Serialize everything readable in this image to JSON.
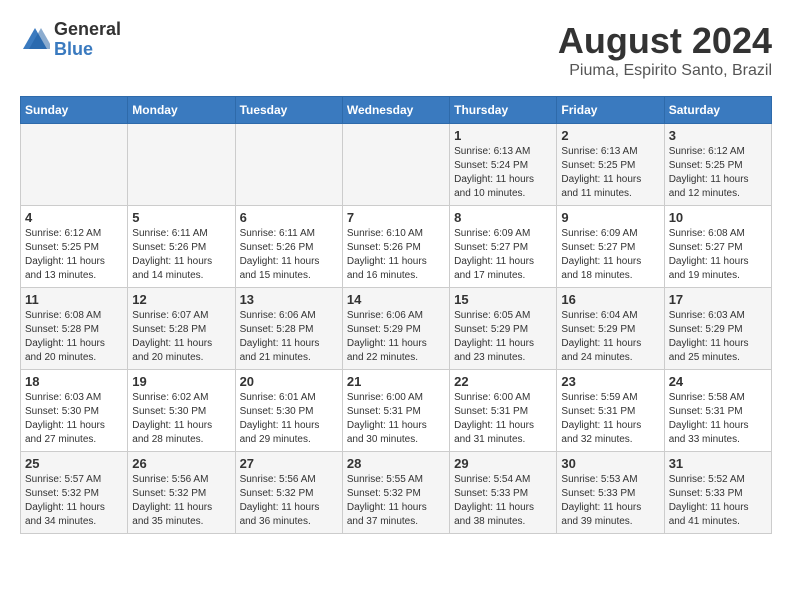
{
  "logo": {
    "line1": "General",
    "line2": "Blue"
  },
  "title": "August 2024",
  "subtitle": "Piuma, Espirito Santo, Brazil",
  "days_of_week": [
    "Sunday",
    "Monday",
    "Tuesday",
    "Wednesday",
    "Thursday",
    "Friday",
    "Saturday"
  ],
  "weeks": [
    [
      {
        "day": "",
        "info": ""
      },
      {
        "day": "",
        "info": ""
      },
      {
        "day": "",
        "info": ""
      },
      {
        "day": "",
        "info": ""
      },
      {
        "day": "1",
        "info": "Sunrise: 6:13 AM\nSunset: 5:24 PM\nDaylight: 11 hours\nand 10 minutes."
      },
      {
        "day": "2",
        "info": "Sunrise: 6:13 AM\nSunset: 5:25 PM\nDaylight: 11 hours\nand 11 minutes."
      },
      {
        "day": "3",
        "info": "Sunrise: 6:12 AM\nSunset: 5:25 PM\nDaylight: 11 hours\nand 12 minutes."
      }
    ],
    [
      {
        "day": "4",
        "info": "Sunrise: 6:12 AM\nSunset: 5:25 PM\nDaylight: 11 hours\nand 13 minutes."
      },
      {
        "day": "5",
        "info": "Sunrise: 6:11 AM\nSunset: 5:26 PM\nDaylight: 11 hours\nand 14 minutes."
      },
      {
        "day": "6",
        "info": "Sunrise: 6:11 AM\nSunset: 5:26 PM\nDaylight: 11 hours\nand 15 minutes."
      },
      {
        "day": "7",
        "info": "Sunrise: 6:10 AM\nSunset: 5:26 PM\nDaylight: 11 hours\nand 16 minutes."
      },
      {
        "day": "8",
        "info": "Sunrise: 6:09 AM\nSunset: 5:27 PM\nDaylight: 11 hours\nand 17 minutes."
      },
      {
        "day": "9",
        "info": "Sunrise: 6:09 AM\nSunset: 5:27 PM\nDaylight: 11 hours\nand 18 minutes."
      },
      {
        "day": "10",
        "info": "Sunrise: 6:08 AM\nSunset: 5:27 PM\nDaylight: 11 hours\nand 19 minutes."
      }
    ],
    [
      {
        "day": "11",
        "info": "Sunrise: 6:08 AM\nSunset: 5:28 PM\nDaylight: 11 hours\nand 20 minutes."
      },
      {
        "day": "12",
        "info": "Sunrise: 6:07 AM\nSunset: 5:28 PM\nDaylight: 11 hours\nand 20 minutes."
      },
      {
        "day": "13",
        "info": "Sunrise: 6:06 AM\nSunset: 5:28 PM\nDaylight: 11 hours\nand 21 minutes."
      },
      {
        "day": "14",
        "info": "Sunrise: 6:06 AM\nSunset: 5:29 PM\nDaylight: 11 hours\nand 22 minutes."
      },
      {
        "day": "15",
        "info": "Sunrise: 6:05 AM\nSunset: 5:29 PM\nDaylight: 11 hours\nand 23 minutes."
      },
      {
        "day": "16",
        "info": "Sunrise: 6:04 AM\nSunset: 5:29 PM\nDaylight: 11 hours\nand 24 minutes."
      },
      {
        "day": "17",
        "info": "Sunrise: 6:03 AM\nSunset: 5:29 PM\nDaylight: 11 hours\nand 25 minutes."
      }
    ],
    [
      {
        "day": "18",
        "info": "Sunrise: 6:03 AM\nSunset: 5:30 PM\nDaylight: 11 hours\nand 27 minutes."
      },
      {
        "day": "19",
        "info": "Sunrise: 6:02 AM\nSunset: 5:30 PM\nDaylight: 11 hours\nand 28 minutes."
      },
      {
        "day": "20",
        "info": "Sunrise: 6:01 AM\nSunset: 5:30 PM\nDaylight: 11 hours\nand 29 minutes."
      },
      {
        "day": "21",
        "info": "Sunrise: 6:00 AM\nSunset: 5:31 PM\nDaylight: 11 hours\nand 30 minutes."
      },
      {
        "day": "22",
        "info": "Sunrise: 6:00 AM\nSunset: 5:31 PM\nDaylight: 11 hours\nand 31 minutes."
      },
      {
        "day": "23",
        "info": "Sunrise: 5:59 AM\nSunset: 5:31 PM\nDaylight: 11 hours\nand 32 minutes."
      },
      {
        "day": "24",
        "info": "Sunrise: 5:58 AM\nSunset: 5:31 PM\nDaylight: 11 hours\nand 33 minutes."
      }
    ],
    [
      {
        "day": "25",
        "info": "Sunrise: 5:57 AM\nSunset: 5:32 PM\nDaylight: 11 hours\nand 34 minutes."
      },
      {
        "day": "26",
        "info": "Sunrise: 5:56 AM\nSunset: 5:32 PM\nDaylight: 11 hours\nand 35 minutes."
      },
      {
        "day": "27",
        "info": "Sunrise: 5:56 AM\nSunset: 5:32 PM\nDaylight: 11 hours\nand 36 minutes."
      },
      {
        "day": "28",
        "info": "Sunrise: 5:55 AM\nSunset: 5:32 PM\nDaylight: 11 hours\nand 37 minutes."
      },
      {
        "day": "29",
        "info": "Sunrise: 5:54 AM\nSunset: 5:33 PM\nDaylight: 11 hours\nand 38 minutes."
      },
      {
        "day": "30",
        "info": "Sunrise: 5:53 AM\nSunset: 5:33 PM\nDaylight: 11 hours\nand 39 minutes."
      },
      {
        "day": "31",
        "info": "Sunrise: 5:52 AM\nSunset: 5:33 PM\nDaylight: 11 hours\nand 41 minutes."
      }
    ]
  ]
}
